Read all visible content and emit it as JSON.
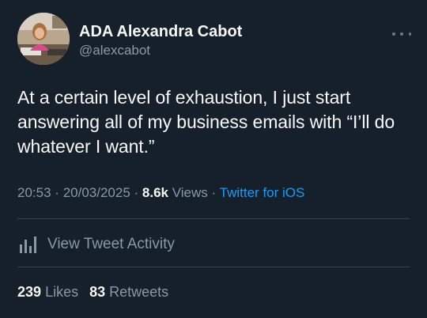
{
  "author": {
    "display_name": "ADA Alexandra Cabot",
    "handle": "@alexcabot"
  },
  "tweet": {
    "text": "At a certain level of exhaustion, I just start answering all of my business emails with “I’ll do whatever I want.”"
  },
  "meta": {
    "time": "20:53",
    "date": "20/03/2025",
    "views_count": "8.6k",
    "views_label": "Views",
    "source": "Twitter for iOS",
    "separator": "·"
  },
  "activity": {
    "label": "View Tweet Activity",
    "icon": "bar-chart-icon"
  },
  "stats": {
    "likes_count": "239",
    "likes_label": "Likes",
    "retweets_count": "83",
    "retweets_label": "Retweets"
  },
  "colors": {
    "background": "#15202b",
    "text": "#f7f9f9",
    "secondary": "#8b98a5",
    "accent": "#1d9bf0",
    "divider": "#38444d"
  }
}
